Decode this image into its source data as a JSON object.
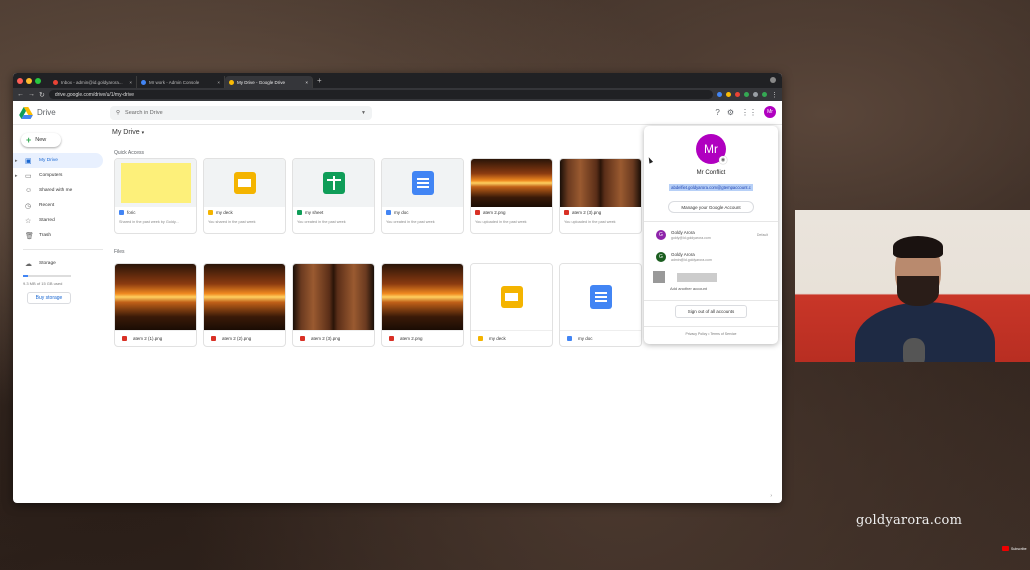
{
  "browser": {
    "tabs": [
      {
        "label": "Inbox - admin@id.goldyarora...",
        "fav": "#ea4335"
      },
      {
        "label": "Mr work - Admin Console",
        "fav": "#4285f4"
      },
      {
        "label": "My Drive - Google Drive",
        "fav": "#fbbc04"
      }
    ],
    "url": "drive.google.com/drive/u/1/my-drive"
  },
  "drive": {
    "title": "Drive",
    "search_placeholder": "Search in Drive",
    "new_label": "New",
    "sidebar": [
      {
        "label": "My Drive",
        "icon": "my-drive-icon",
        "glyph": "▣",
        "active": true,
        "expand": true
      },
      {
        "label": "Computers",
        "icon": "computer-icon",
        "glyph": "▭",
        "expand": true
      },
      {
        "label": "Shared with me",
        "icon": "shared-icon",
        "glyph": "☺"
      },
      {
        "label": "Recent",
        "icon": "clock-icon",
        "glyph": "◷"
      },
      {
        "label": "Starred",
        "icon": "star-icon",
        "glyph": "☆"
      },
      {
        "label": "Trash",
        "icon": "trash-icon",
        "glyph": "🗑"
      }
    ],
    "storage_label": "Storage",
    "storage_used": "9.3 MB of 15 GB used",
    "storage_fraction": 0.1,
    "buy_storage": "Buy storage",
    "location": "My Drive",
    "quick_access_label": "Quick Access",
    "files_label": "Files",
    "quick_access": [
      {
        "name": "foric",
        "sub": "Shared in the past week by Goldy...",
        "thumb": "note",
        "type": "doc"
      },
      {
        "name": "my deck",
        "sub": "You shared in the past week",
        "thumb": "slides",
        "type": "slides"
      },
      {
        "name": "my sheet",
        "sub": "You created in the past week",
        "thumb": "sheets",
        "type": "sheets"
      },
      {
        "name": "my doc",
        "sub": "You created in the past week",
        "thumb": "doc",
        "type": "doc"
      },
      {
        "name": "atem 2.png",
        "sub": "You uploaded in the past week",
        "thumb": "sunset",
        "type": "image"
      },
      {
        "name": "atem 2 (3).png",
        "sub": "You uploaded in the past week",
        "thumb": "doors",
        "type": "image"
      }
    ],
    "files": [
      {
        "name": "atem 2 (1).png",
        "thumb": "sunset",
        "type": "image"
      },
      {
        "name": "atem 2 (2).png",
        "thumb": "sunset",
        "type": "image"
      },
      {
        "name": "atem 2 (3).png",
        "thumb": "doors",
        "type": "image"
      },
      {
        "name": "atem 2.png",
        "thumb": "sunset",
        "type": "image"
      },
      {
        "name": "my deck",
        "thumb": "slides",
        "type": "slides"
      },
      {
        "name": "my doc",
        "thumb": "doc",
        "type": "doc"
      }
    ]
  },
  "account": {
    "initials": "Mr",
    "name": "Mr Conflict",
    "email": "abdelfiet.goldyarora.com@gtempaccount.c",
    "manage_label": "Manage your Google Account",
    "others": [
      {
        "initial": "G",
        "name": "Goldy Arora",
        "email": "goldy@id.goldyarora.com",
        "badge": "Default",
        "color": "#8e24aa"
      },
      {
        "initial": "G",
        "name": "Goldy Arora",
        "email": "admin@id.goldyarora.com",
        "badge": "",
        "color": "#1b5e20"
      }
    ],
    "add_account": "Add another account",
    "sign_out": "Sign out of all accounts",
    "footer": "Privacy Policy  •  Terms of Service"
  },
  "watermark": "goldyarora.com",
  "youtube_label": "Subscribe",
  "colors": {
    "doc": "#4285f4",
    "slides": "#f4b400",
    "sheets": "#0f9d58",
    "image": "#d93025",
    "accent": "#1967d2"
  }
}
